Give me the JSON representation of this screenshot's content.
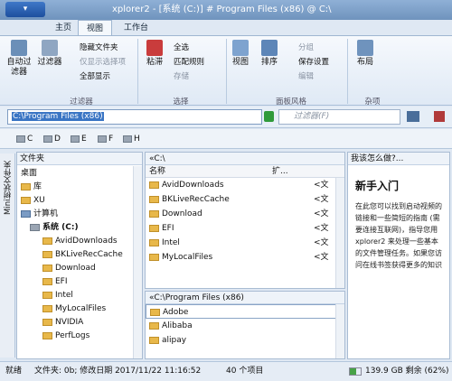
{
  "window": {
    "title": "xplorer2 - [系统 (C:)] # Program Files (x86) @ C:\\",
    "menu_label": "▾"
  },
  "tabs": [
    "主页",
    "视图",
    "工作台"
  ],
  "ribbon": {
    "buttons": [
      "自动过滤器",
      "过滤器",
      "粘滞",
      "视图",
      "排序",
      "分组",
      "布局"
    ],
    "small": [
      "隐藏文件夹",
      "仅显示选择项",
      "全部显示",
      "全选",
      "匹配规则",
      "存储",
      "分组",
      "保存设置",
      "编辑"
    ],
    "groups": [
      "过滤器",
      "选择",
      "面板风格",
      "杂项"
    ]
  },
  "address": {
    "value": "C:\\Program Files (x86)",
    "filter_placeholder": "过滤器(F)"
  },
  "drives": [
    "C",
    "D",
    "E",
    "F",
    "H"
  ],
  "vertical_tab": "Mini树状文件夹",
  "tree": {
    "header": "文件夹",
    "items": [
      "桌面",
      "库",
      "XU",
      "计算机",
      "系统 (C:)",
      "AvidDownloads",
      "BKLiveRecCache",
      "Download",
      "EFI",
      "Intel",
      "MyLocalFiles",
      "NVIDIA",
      "PerfLogs"
    ]
  },
  "pane1": {
    "path": "«C:\\",
    "col_name": "名称",
    "col_ext": "扩...",
    "rows": [
      {
        "name": "AvidDownloads",
        "type": "<文"
      },
      {
        "name": "BKLiveRecCache",
        "type": "<文"
      },
      {
        "name": "Download",
        "type": "<文"
      },
      {
        "name": "EFI",
        "type": "<文"
      },
      {
        "name": "Intel",
        "type": "<文"
      },
      {
        "name": "MyLocalFiles",
        "type": "<文"
      }
    ]
  },
  "pane2": {
    "path": "«C:\\Program Files (x86)",
    "rows": [
      {
        "name": "Adobe"
      },
      {
        "name": "Alibaba"
      },
      {
        "name": "alipay"
      }
    ]
  },
  "help": {
    "header": "我该怎么做?...",
    "title": "新手入门",
    "body": "在此您可以找到启动视频的链接和一些简短的指南 (需要连接互联网)，指导您用 xplorer2 来处理一些基本的文件管理任务。如果您访问在线书签获得更多的知识"
  },
  "status": {
    "ready": "就绪",
    "info": "文件夹: 0b; 修改日期 2017/11/22 11:16:52",
    "count": "40 个项目",
    "free": "139.9 GB 剩余 (62%)",
    "free_fraction": 0.62
  },
  "colors": {
    "accent": "#3a75c4",
    "folder": "#e8b84a",
    "title": "#6f93bd"
  }
}
